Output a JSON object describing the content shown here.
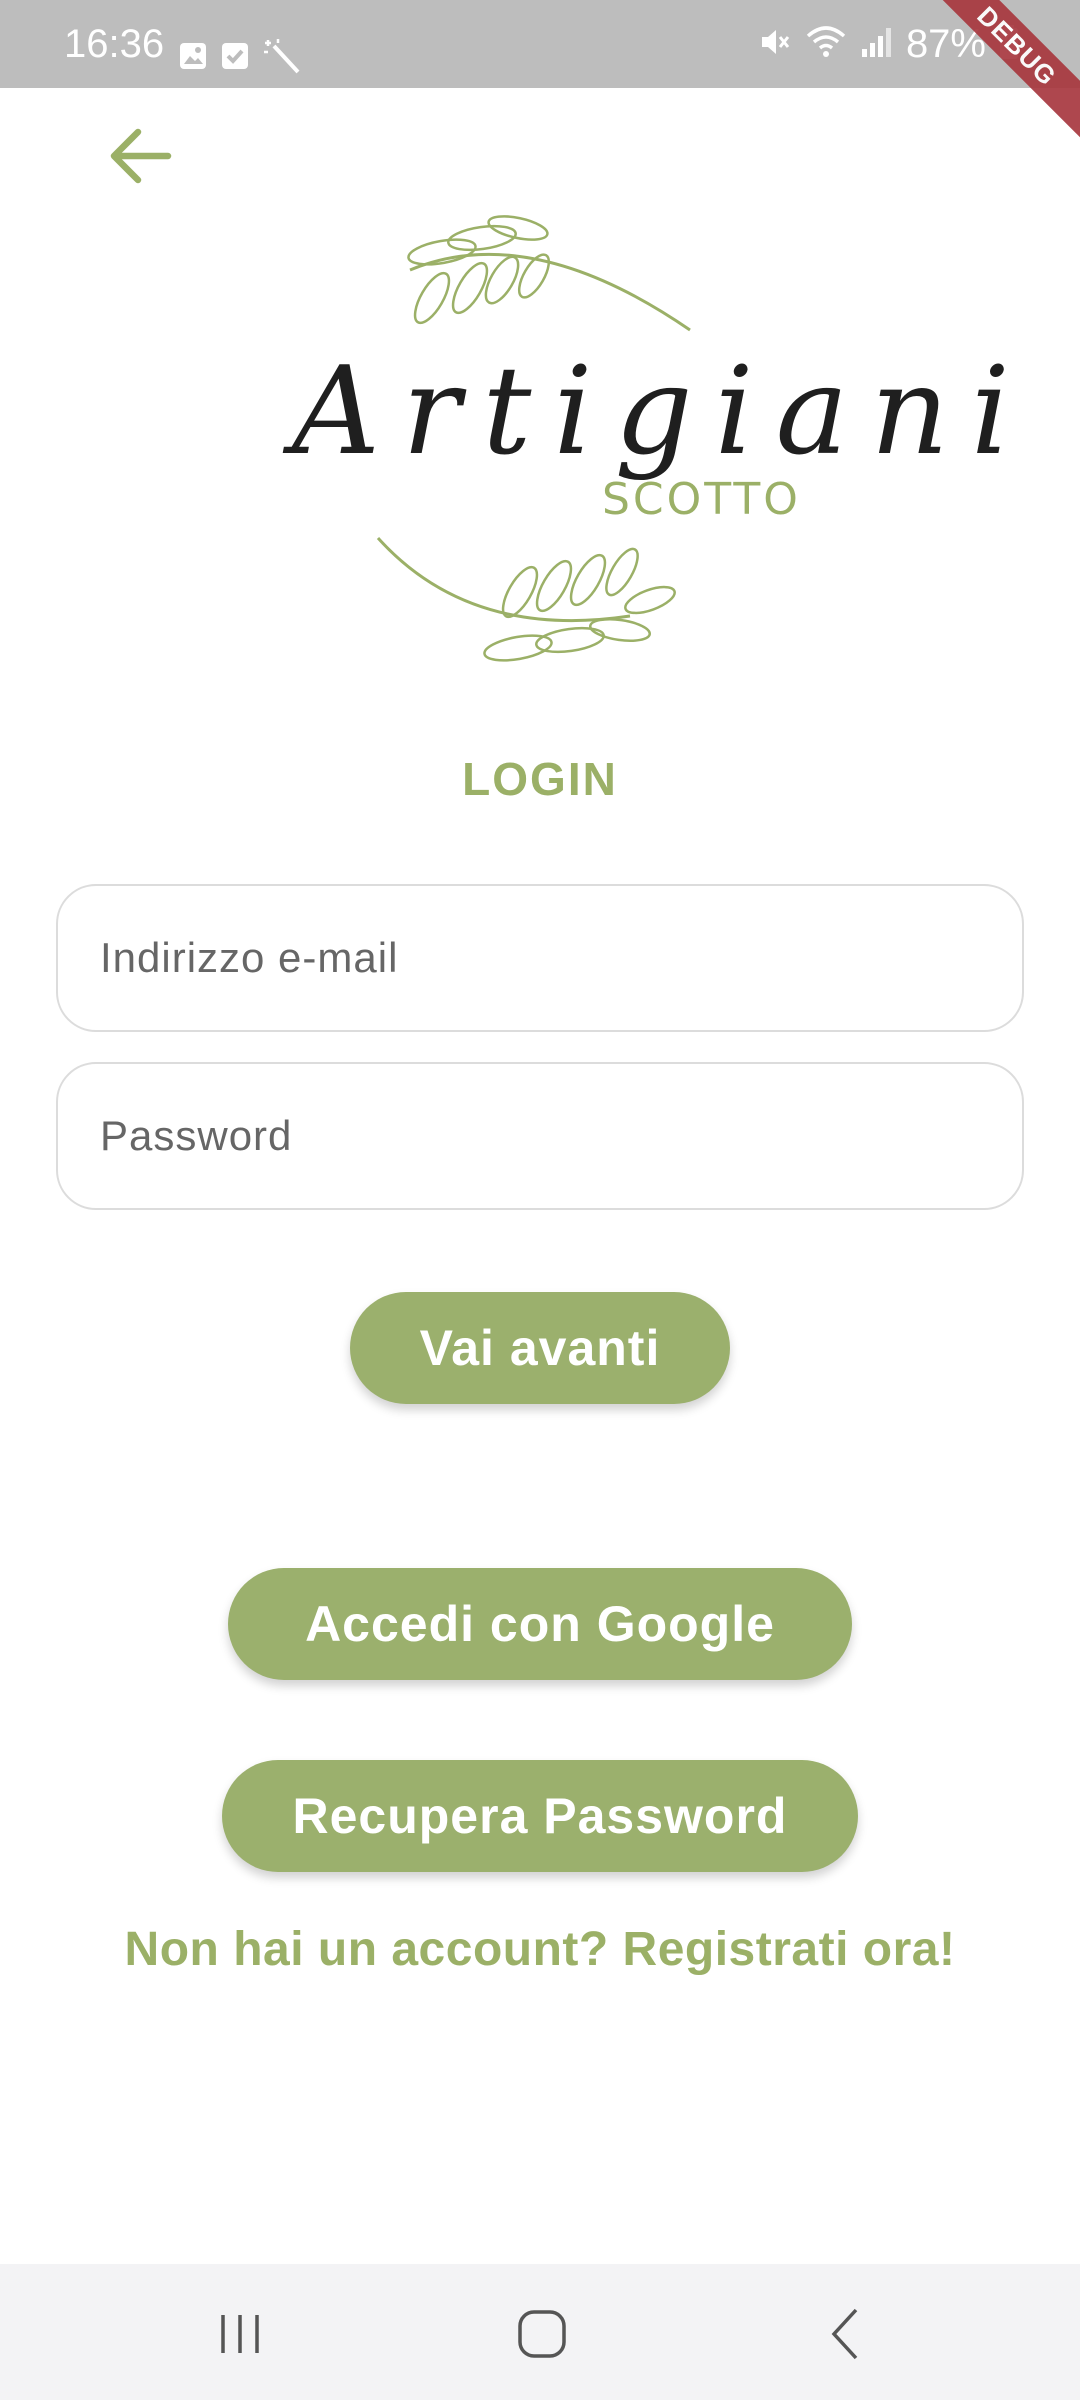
{
  "status_bar": {
    "time": "16:36",
    "battery": "87%",
    "debug_label": "DEBUG",
    "left_icons": [
      "gallery-icon",
      "checkbox-icon",
      "magic-wand-icon"
    ],
    "right_icons": [
      "mute-icon",
      "wifi-icon",
      "signal-icon",
      "battery-icon"
    ]
  },
  "logo": {
    "title": "Artigiani",
    "subtitle": "SCOTTO"
  },
  "login": {
    "title": "LOGIN",
    "email_placeholder": "Indirizzo e-mail",
    "password_placeholder": "Password",
    "submit_label": "Vai avanti",
    "google_label": "Accedi con Google",
    "recover_label": "Recupera Password",
    "register_text": "Non hai un account? Registrati ora!"
  },
  "colors": {
    "accent": "#9bb067",
    "button": "#9bb06d",
    "status_bar": "#bdbdbd",
    "debug_ribbon": "#a8383f"
  },
  "navigation": [
    "recent-apps",
    "home",
    "back"
  ]
}
